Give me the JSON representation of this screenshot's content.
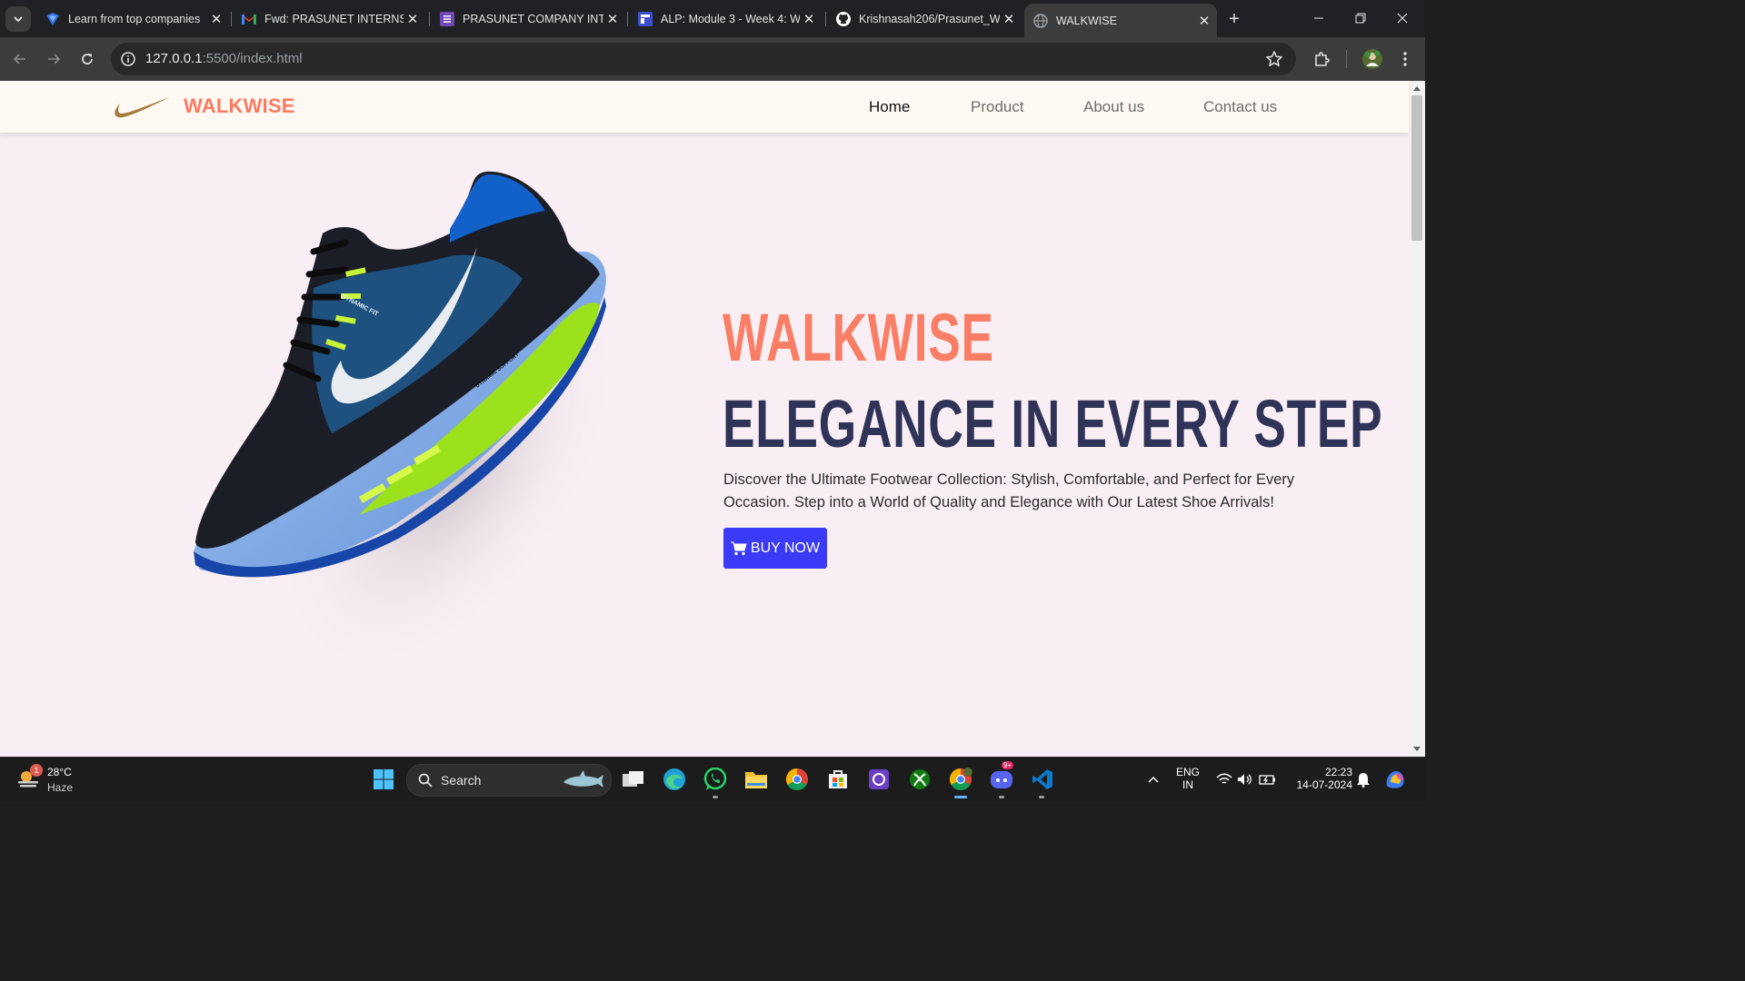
{
  "browser": {
    "tabs": [
      {
        "title": "Learn from top companies",
        "favicon": "blue-diamond-icon"
      },
      {
        "title": "Fwd: PRASUNET INTERNSHIP",
        "favicon": "gmail-icon"
      },
      {
        "title": "PRASUNET COMPANY INTERNSHIP",
        "favicon": "forms-icon"
      },
      {
        "title": "ALP: Module 3 - Week 4: W",
        "favicon": "classroom-icon"
      },
      {
        "title": "Krishnasah206/Prasunet_W",
        "favicon": "github-icon"
      },
      {
        "title": "WALKWISE",
        "favicon": "globe-icon"
      }
    ],
    "url_host": "127.0.0.1",
    "url_rest": ":5500/index.html"
  },
  "site": {
    "brand": "WALKWISE",
    "nav": [
      "Home",
      "Product",
      "About us",
      "Contact us"
    ],
    "hero": {
      "title": "WALKWISE",
      "subtitle": "ELEGANCE IN EVERY STEP",
      "description": "Discover the Ultimate Footwear Collection: Stylish, Comfortable, and Perfect for Every Occasion. Step into a World of Quality and Elegance with Our Latest Shoe Arrivals!",
      "button": "BUY NOW"
    },
    "shoe_text": [
      "DYNAMIC FIT",
      "DYNAMIC SUPPORT"
    ],
    "colors": {
      "accent": "#fa7a60",
      "dark": "#2f3357",
      "button": "#3b3bf7"
    }
  },
  "taskbar": {
    "weather_temp": "28°C",
    "weather_cond": "Haze",
    "weather_badge": "1",
    "search_label": "Search",
    "discord_badge": "9+",
    "lang_top": "ENG",
    "lang_bottom": "IN",
    "time": "22:23",
    "date": "14-07-2024"
  }
}
